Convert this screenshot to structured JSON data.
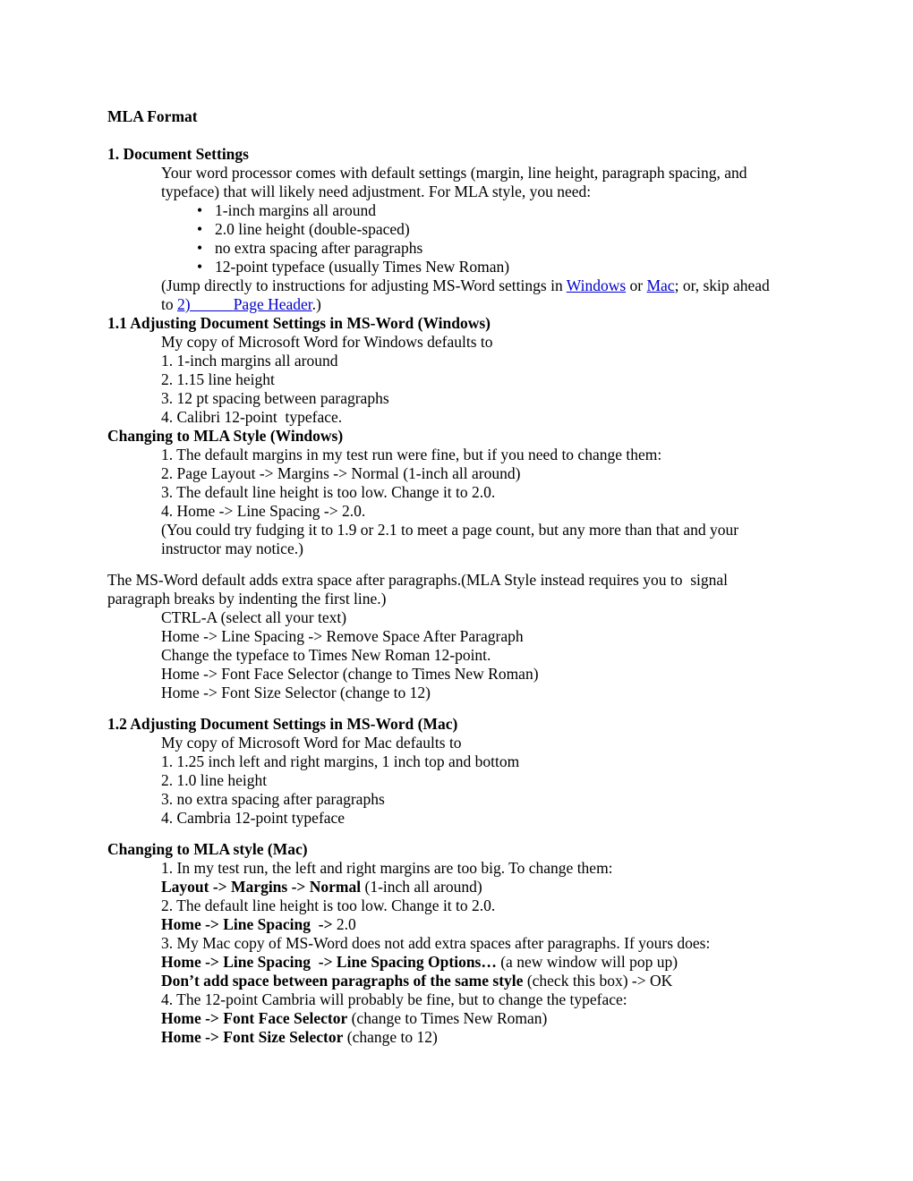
{
  "document": {
    "title": "MLA Format",
    "sections": [
      {
        "heading": "1. Document Settings",
        "intro": "Your word processor comes with default settings (margin, line height, paragraph spacing, and typeface) that will likely need adjustment. For MLA style, you need:",
        "bullets": [
          "1-inch margins all around",
          "2.0 line height (double-spaced)",
          "no extra spacing after paragraphs",
          "12-point typeface (usually Times New Roman)"
        ],
        "jump_note": {
          "before": "(Jump directly to instructions for adjusting MS-Word settings in ",
          "link_windows": "Windows",
          "between": " or ",
          "link_mac": "Mac",
          "after_mac": "; or, skip ahead  to ",
          "link_number": "2)",
          "link_wrap_pad": "           ",
          "link_page_header": "Page Header",
          "closing": ".)"
        }
      }
    ],
    "windows_section": {
      "heading": "1.1 Adjusting Document Settings in MS-Word (Windows)",
      "intro": "My copy of Microsoft Word for Windows defaults to",
      "defaults": [
        "1. 1-inch margins all around",
        "2. 1.15 line height",
        "3. 12 pt spacing between paragraphs",
        "4. Calibri 12-point  typeface."
      ],
      "change_heading": "Changing to MLA Style (Windows)",
      "change_steps": [
        "1. The default margins in my test run were fine, but if you need to change them:",
        "2. Page Layout -> Margins -> Normal (1-inch all around)",
        "3. The default line height is too low. Change it to 2.0.",
        "4. Home -> Line Spacing -> 2.0.",
        "(You could try fudging it to 1.9 or 2.1 to meet a page count, but any more than that and your instructor may notice.)"
      ],
      "paragraph_note": "The MS-Word default adds extra space after paragraphs.(MLA Style instead requires you to  signal paragraph breaks by indenting the first line.)",
      "paragraph_steps": [
        "CTRL-A (select all your text)",
        "Home -> Line Spacing -> Remove Space After Paragraph",
        "Change the typeface to Times New Roman 12-point.",
        "Home -> Font Face Selector (change to Times New Roman)",
        "Home -> Font Size Selector (change to 12)"
      ]
    },
    "mac_section": {
      "heading": "1.2 Adjusting Document Settings in MS-Word (Mac)",
      "intro": "My copy of Microsoft Word for Mac defaults to",
      "defaults": [
        "1. 1.25 inch left and right margins, 1 inch top and bottom",
        "2. 1.0 line height",
        "3. no extra spacing after paragraphs",
        "4. Cambria 12-point typeface"
      ],
      "change_heading": "Changing to MLA style (Mac)",
      "steps": [
        {
          "bold": "",
          "plain": "1. In my test run, the left and right margins are too big. To change them:"
        },
        {
          "bold": "Layout -> Margins -> Normal",
          "plain": " (1-inch all around)"
        },
        {
          "bold": "",
          "plain": "2. The default line height is too low. Change it to 2.0."
        },
        {
          "bold": "Home -> Line Spacing  ->",
          "plain": " 2.0"
        },
        {
          "bold": "",
          "plain": "3. My Mac copy of MS-Word does not add extra spaces after paragraphs. If yours does:"
        },
        {
          "bold": "Home -> Line Spacing  -> Line Spacing Options…",
          "plain": " (a new window will pop up)"
        },
        {
          "bold": "Don’t add space between paragraphs of the same style",
          "plain": " (check this box) -> OK"
        },
        {
          "bold": "",
          "plain": "4. The 12-point Cambria will probably be fine, but to change the typeface:"
        },
        {
          "bold": "Home -> Font Face Selector",
          "plain": " (change to Times New Roman)"
        },
        {
          "bold": "Home -> Font Size Selector",
          "plain": " (change to 12)"
        }
      ]
    },
    "bullet_glyph": "•",
    "colors": {
      "link": "#0000cc",
      "text": "#000000",
      "background": "#ffffff"
    }
  }
}
